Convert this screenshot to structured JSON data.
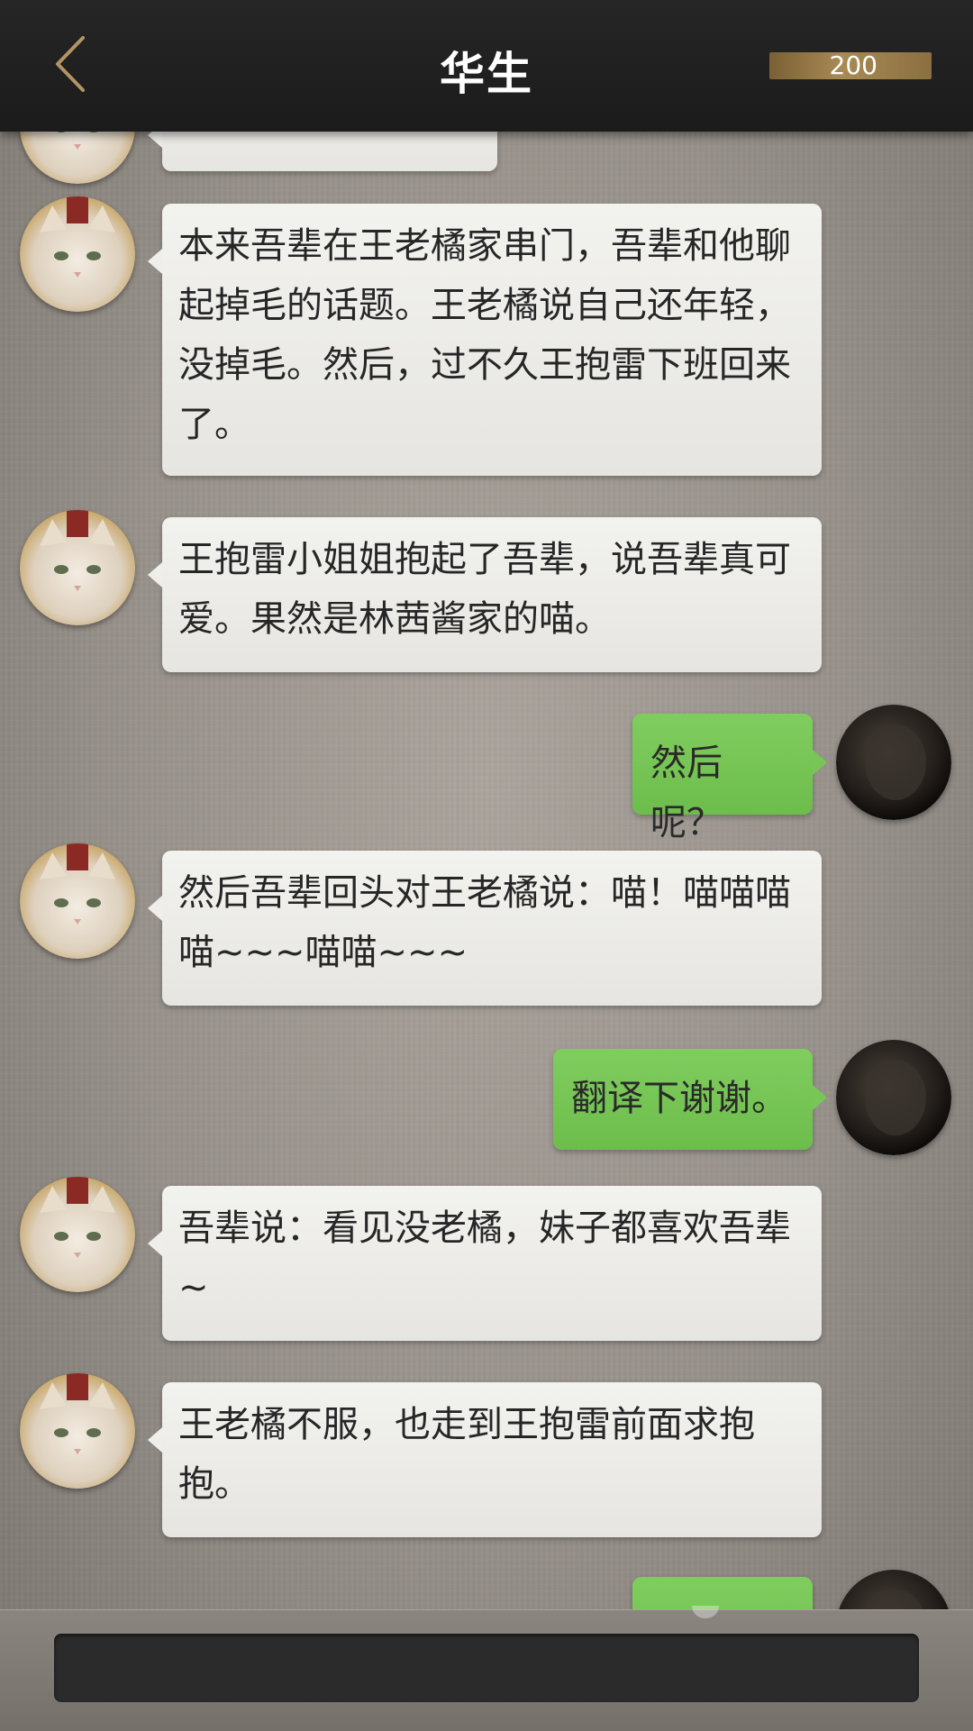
{
  "header": {
    "title": "华生",
    "coins": "200",
    "back_icon": "chevron-left-icon"
  },
  "messages": [
    {
      "side": "left",
      "text": ""
    },
    {
      "side": "left",
      "text": "本来吾辈在王老橘家串门，吾辈和他聊起掉毛的话题。王老橘说自己还年轻，没掉毛。然后，过不久王抱雷下班回来了。"
    },
    {
      "side": "left",
      "text": "王抱雷小姐姐抱起了吾辈，说吾辈真可爱。果然是林茜酱家的喵。"
    },
    {
      "side": "right",
      "text": "然后呢？"
    },
    {
      "side": "left",
      "text": "然后吾辈回头对王老橘说：喵！喵喵喵喵~~~喵喵~~~"
    },
    {
      "side": "right",
      "text": "翻译下谢谢。"
    },
    {
      "side": "left",
      "text": "吾辈说：看见没老橘，妹子都喜欢吾辈~"
    },
    {
      "side": "left",
      "text": "王老橘不服，也走到王抱雷前面求抱抱。"
    },
    {
      "side": "right",
      "text": ""
    }
  ],
  "input": {
    "value": "",
    "placeholder": ""
  },
  "colors": {
    "header_bg": "#1f1f1f",
    "left_bubble": "#ecebe8",
    "right_bubble": "#76c455",
    "coin_bar": "#a88a55"
  }
}
